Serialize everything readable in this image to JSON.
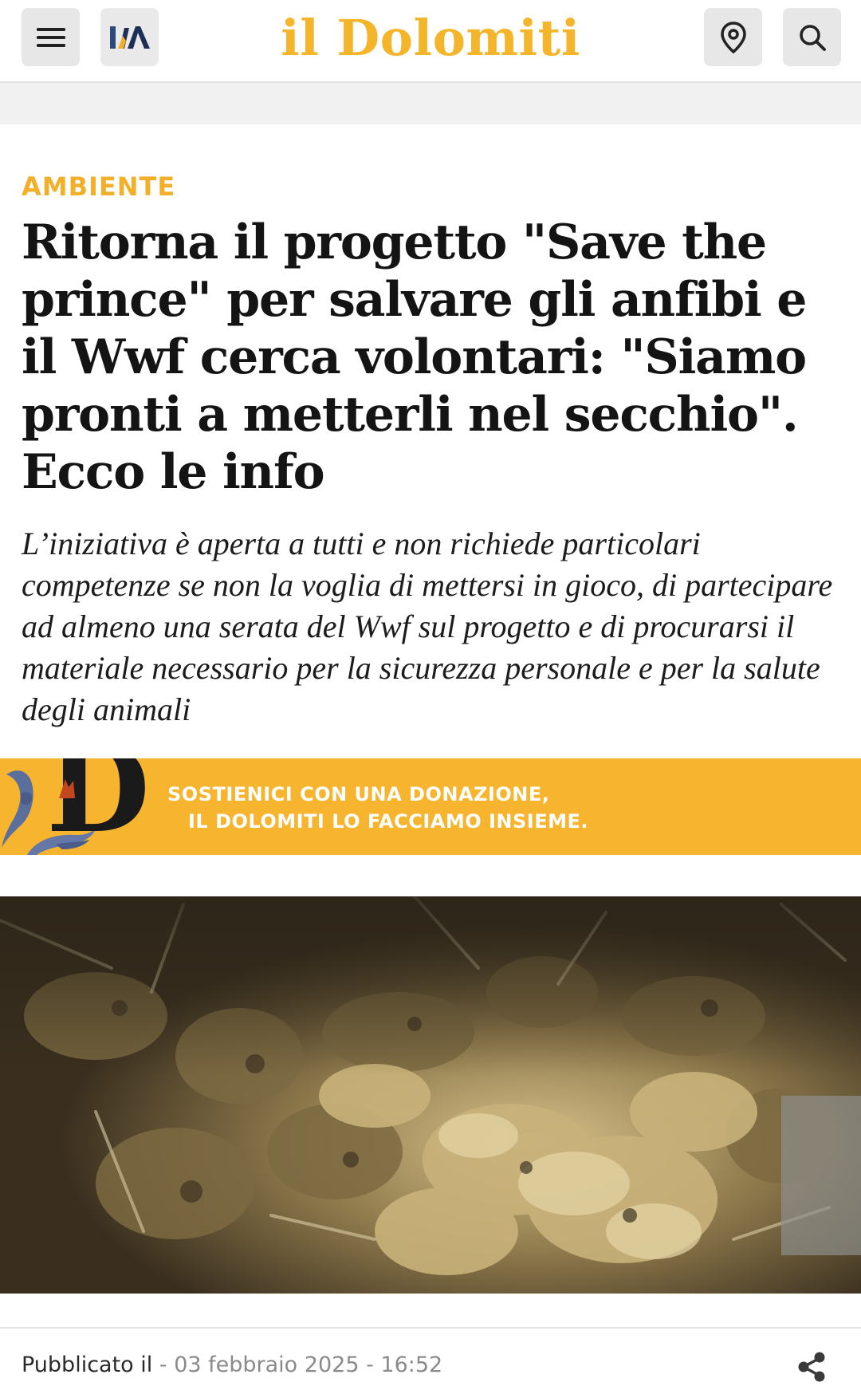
{
  "header": {
    "brand": "il Dolomiti",
    "menu_icon": "hamburger-menu-icon",
    "language_icon": "language-switch-icon",
    "location_icon": "location-pin-icon",
    "search_icon": "search-icon",
    "brand_color": "#f4b52b"
  },
  "article": {
    "category": "AMBIENTE",
    "title": "Ritorna il progetto \"Save the prince\" per salvare gli anfibi e il Wwf cerca volontari: \"Siamo pronti a metterli nel secchio\". Ecco le info",
    "subtitle": "L’iniziativa è aperta a tutti e non richiede particolari competenze se non la voglia di mettersi in gioco, di partecipare ad almeno una serata del Wwf sul progetto e di procurarsi il materiale necessario per la sicurezza personale e per la salute degli animali",
    "accent_color": "#f2b02a"
  },
  "donation_banner": {
    "line1": "SOSTIENICI CON UNA DONAZIONE,",
    "line2": "IL DOLOMITI LO FACCIAMO INSIEME.",
    "background": "#f7b42e"
  },
  "photo": {
    "subject": "toads-in-bucket-photo"
  },
  "meta": {
    "published_label": "Pubblicato il",
    "separator": " - ",
    "date": "03 febbraio 2025 - 16:52",
    "share_icon": "share-icon"
  }
}
